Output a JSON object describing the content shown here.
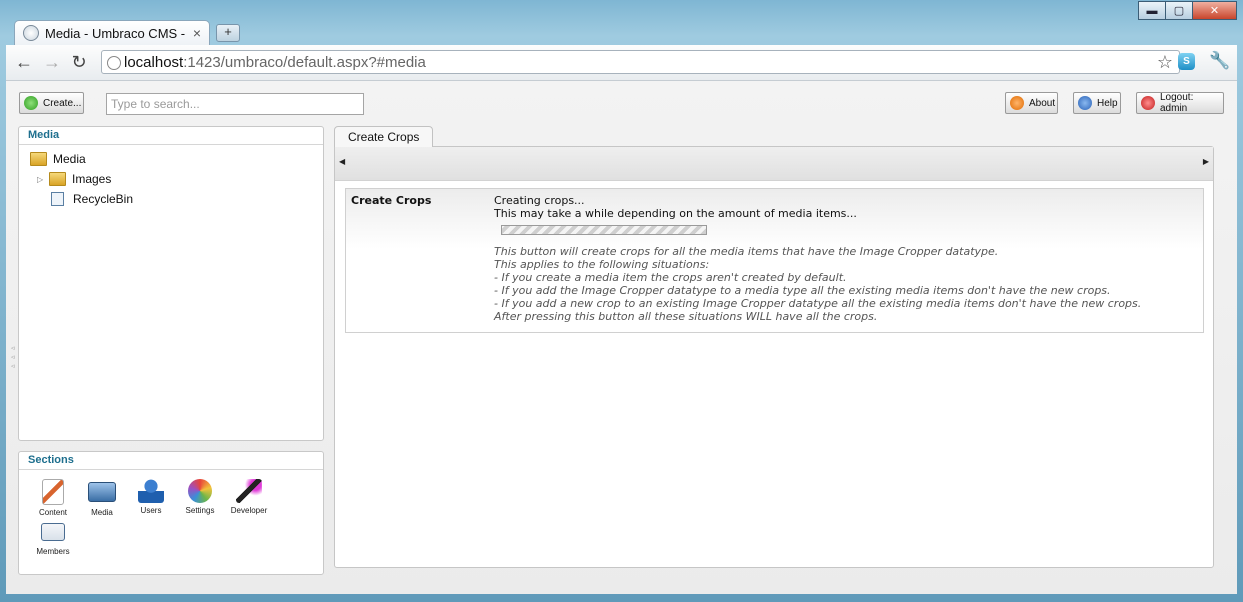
{
  "browser": {
    "tab_title": "Media - Umbraco CMS - lo",
    "new_tab": "+",
    "url_host": "localhost",
    "url_rest": ":1423/umbraco/default.aspx?#media",
    "window_controls": {
      "minimize": "▬",
      "maximize": "▢",
      "close": "✕"
    }
  },
  "header": {
    "create_label": "Create...",
    "search_placeholder": "Type to search...",
    "about_label": "About",
    "help_label": "Help",
    "logout_label": "Logout: admin"
  },
  "tree": {
    "title": "Media",
    "root": "Media",
    "items": [
      {
        "label": "Images",
        "icon": "folder-icon",
        "expandable": true
      },
      {
        "label": "RecycleBin",
        "icon": "recycle-bin-icon",
        "expandable": false
      }
    ]
  },
  "sections": {
    "title": "Sections",
    "items": [
      {
        "label": "Content",
        "icon": "content-icon",
        "color": "#d8642e"
      },
      {
        "label": "Media",
        "icon": "media-icon",
        "color": "#3a6ea5"
      },
      {
        "label": "Users",
        "icon": "users-icon",
        "color": "#1f5fae"
      },
      {
        "label": "Settings",
        "icon": "settings-icon",
        "color": "#6bb54a"
      },
      {
        "label": "Developer",
        "icon": "developer-icon",
        "color": "#7a2b8c"
      },
      {
        "label": "Members",
        "icon": "members-icon",
        "color": "#4a6c91"
      }
    ]
  },
  "content": {
    "tab_label": "Create Crops",
    "property_label": "Create Crops",
    "status_lines": [
      "Creating crops...",
      "This may take a while depending on the amount of media items..."
    ],
    "description_lines": [
      "This button will create crops for all the media items that have the Image Cropper datatype.",
      "This applies to the following situations:",
      "- If you create a media item the crops aren't created by default.",
      "- If you add the Image Cropper datatype to a media type all the existing media items don't have the new crops.",
      "- If you add a new crop to an existing Image Cropper datatype all the existing media items don't have the new crops.",
      "After pressing this button all these situations WILL have all the crops."
    ]
  }
}
